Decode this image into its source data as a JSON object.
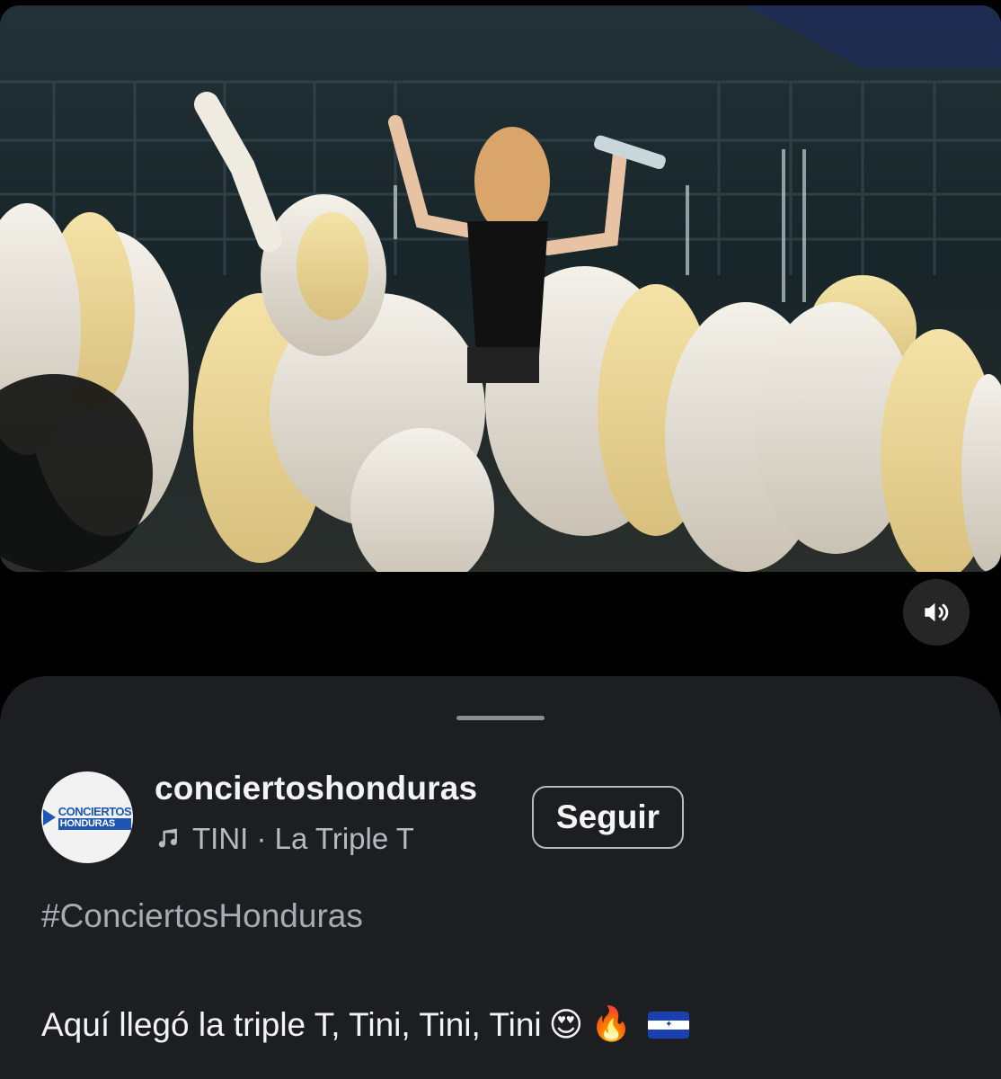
{
  "post": {
    "username": "conciertoshonduras",
    "avatar_logo": {
      "line1": "CONCIERTOS",
      "line2": "HONDURAS"
    },
    "music": {
      "icon": "music-note-icon",
      "text": "TINI · La Triple T"
    },
    "follow_label": "Seguir",
    "hashtag": "#ConciertosHonduras",
    "caption": "Aquí llegó la triple T, Tini, Tini, Tini",
    "caption_emojis": [
      "😍",
      "🔥"
    ],
    "caption_flag": "honduras-flag"
  },
  "video": {
    "audio_icon": "speaker-on-icon"
  },
  "colors": {
    "sheet_bg": "#1c1e22",
    "text_primary": "#f3f3f3",
    "text_secondary": "#a8abb1"
  }
}
